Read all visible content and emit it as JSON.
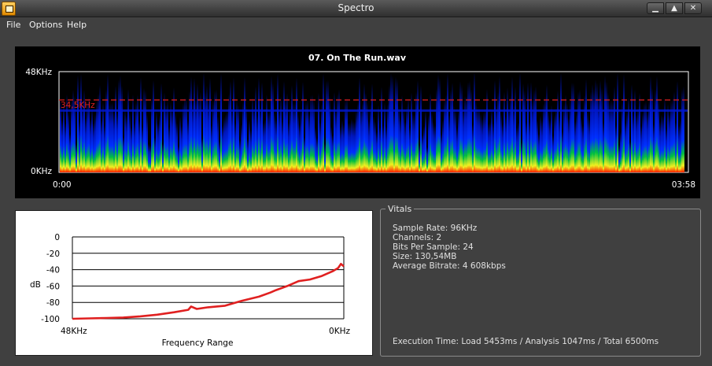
{
  "window": {
    "title": "Spectro",
    "minimize_glyph": "▁",
    "maximize_glyph": "▲",
    "close_glyph": "✕"
  },
  "menu": {
    "items": [
      "File",
      "Options",
      "Help"
    ]
  },
  "spectrogram": {
    "file_title": "07. On The Run.wav",
    "freq_top_label": "48KHz",
    "freq_bottom_label": "0KHz",
    "time_start_label": "0:00",
    "time_end_label": "03:58",
    "cutoff_label": "34,5KHz",
    "cutoff_khz": 34.5,
    "max_khz": 48,
    "duration_seconds": 238,
    "cutoff_line_color": "#e02020",
    "colors": {
      "high": "#0018d0",
      "mid": "#00c040",
      "low": "#f0f020",
      "floor": "#ff2000"
    }
  },
  "chart_data": {
    "type": "line",
    "ylabel": "dB",
    "xlabel": "Frequency Range",
    "x_start_label": "48KHz",
    "x_end_label": "0KHz",
    "ylim": [
      -100,
      0
    ],
    "y_ticks": [
      "0",
      "-20",
      "-40",
      "-60",
      "-80",
      "-100"
    ],
    "grid": true,
    "line_color": "#e02020",
    "series": [
      {
        "x": [
          48,
          45,
          42,
          39,
          36,
          33,
          30,
          27.5,
          27,
          26,
          24,
          21,
          18,
          15,
          13,
          12,
          10,
          8,
          6,
          4,
          2,
          1,
          0.5,
          0
        ],
        "values": [
          -100,
          -99.5,
          -99,
          -98.5,
          -97,
          -95,
          -92,
          -89,
          -85,
          -88,
          -86,
          -84,
          -78,
          -73,
          -68,
          -65,
          -60,
          -54,
          -52,
          -48,
          -42,
          -38,
          -33,
          -36
        ]
      }
    ]
  },
  "vitals": {
    "legend": "Vitals",
    "lines": [
      "Sample Rate: 96KHz",
      "Channels: 2",
      "Bits Per Sample: 24",
      "Size: 130,54MB",
      "Average Bitrate: 4 608kbps"
    ],
    "execution_time": "Execution Time: Load 5453ms / Analysis 1047ms / Total 6500ms"
  }
}
